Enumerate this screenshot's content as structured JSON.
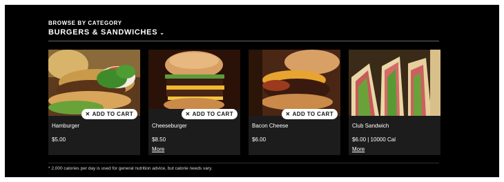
{
  "header": {
    "browse_label": "BROWSE BY CATEGORY",
    "category_selected": "BURGERS & SANDWICHES",
    "chevron_icon": "chevron-down-icon"
  },
  "cards": [
    {
      "name": "Hamburger",
      "price": "$5.00",
      "more": "",
      "cart_label": "ADD TO CART"
    },
    {
      "name": "Cheeseburger",
      "price": "$8.50",
      "more": "More",
      "cart_label": "ADD TO CART"
    },
    {
      "name": "Bacon Cheese",
      "price": "$6.00",
      "more": "",
      "cart_label": "ADD TO CART"
    },
    {
      "name": "Club Sandwich",
      "price": "$6.00  |  10000 Cal",
      "more": "More",
      "cart_label": ""
    }
  ],
  "cart_icon": "fork-knife-icon",
  "footnote": "* 2,000 calories per day is used for general nutrition advice, but calorie needs vary.",
  "colors": {
    "background": "#000000",
    "card": "#1c1c1c",
    "text": "#ffffff",
    "button": "#ffffff"
  }
}
